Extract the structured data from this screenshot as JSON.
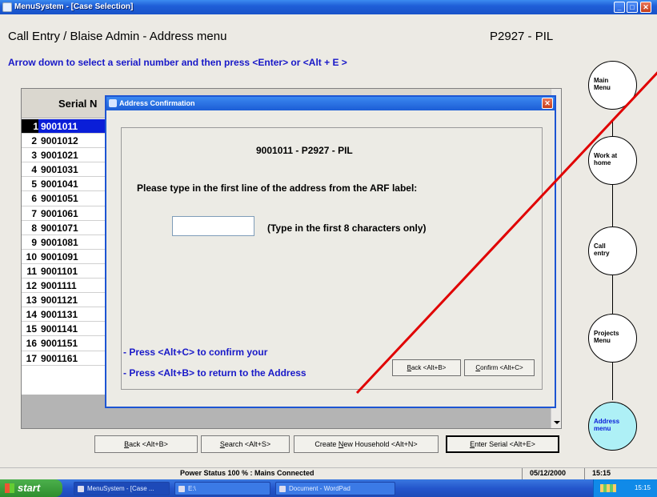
{
  "window": {
    "title": "MenuSystem - [Case Selection]",
    "minimize": "_",
    "maximize": "□",
    "close": "✕"
  },
  "header": {
    "title": "Call Entry / Blaise Admin - Address menu",
    "code": "P2927 - PIL"
  },
  "instruction": "Arrow down to select a serial number and then press <Enter> or <Alt + E >",
  "grid": {
    "column_header": "Serial N",
    "rows": [
      {
        "num": "1",
        "serial": "9001011",
        "selected": true
      },
      {
        "num": "2",
        "serial": "9001012"
      },
      {
        "num": "3",
        "serial": "9001021"
      },
      {
        "num": "4",
        "serial": "9001031"
      },
      {
        "num": "5",
        "serial": "9001041"
      },
      {
        "num": "6",
        "serial": "9001051"
      },
      {
        "num": "7",
        "serial": "9001061"
      },
      {
        "num": "8",
        "serial": "9001071"
      },
      {
        "num": "9",
        "serial": "9001081"
      },
      {
        "num": "10",
        "serial": "9001091"
      },
      {
        "num": "11",
        "serial": "9001101"
      },
      {
        "num": "12",
        "serial": "9001111"
      },
      {
        "num": "13",
        "serial": "9001121"
      },
      {
        "num": "14",
        "serial": "9001131"
      },
      {
        "num": "15",
        "serial": "9001141"
      },
      {
        "num": "16",
        "serial": "9001151"
      },
      {
        "num": "17",
        "serial": "9001161"
      }
    ]
  },
  "dialog": {
    "title": "Address Confirmation",
    "close": "✕",
    "case_label": "9001011 - P2927 - PIL",
    "prompt": "Please type in the first line of the address from the ARF label:",
    "input_value": "",
    "hint": "(Type in the first 8 characters only)",
    "note1": "- Press <Alt+C> to confirm your",
    "note2": "- Press <Alt+B> to return to the Address",
    "back_button": {
      "key": "B",
      "rest": "ack <Alt+B>"
    },
    "confirm_button": {
      "key": "C",
      "rest": "onfirm <Alt+C>"
    }
  },
  "bottom_buttons": [
    {
      "key": "B",
      "rest": "ack <Alt+B>"
    },
    {
      "key": "S",
      "rest": "earch <Alt+S>"
    },
    {
      "pre": "Create ",
      "key": "N",
      "rest": "ew Household <Alt+N>"
    },
    {
      "key": "E",
      "rest": "nter Serial <Alt+E>"
    }
  ],
  "nav_circles": [
    {
      "label": "Main Menu",
      "line1": "Main",
      "line2": "Menu"
    },
    {
      "label": "Work at home",
      "line1": "Work at",
      "line2": "home"
    },
    {
      "label": "Call entry",
      "line1": "Call",
      "line2": "entry"
    },
    {
      "label": "Projects Menu",
      "line1": "Projects",
      "line2": "Menu"
    },
    {
      "label": "Address menu",
      "line1": "Address",
      "line2": "menu",
      "active": true
    }
  ],
  "status": {
    "power": "Power Status 100 % : Mains Connected",
    "date": "05/12/2000",
    "time": "15:15"
  },
  "taskbar": {
    "start": "start",
    "items": [
      "MenuSystem - [Case ...",
      "E:\\",
      "Document - WordPad"
    ],
    "clock": "15:15"
  },
  "colors": {
    "instruction_blue": "#1818c8",
    "selection_blue": "#0a1ed8",
    "active_circle": "#aef0f6",
    "annotation_red": "#e00000"
  }
}
